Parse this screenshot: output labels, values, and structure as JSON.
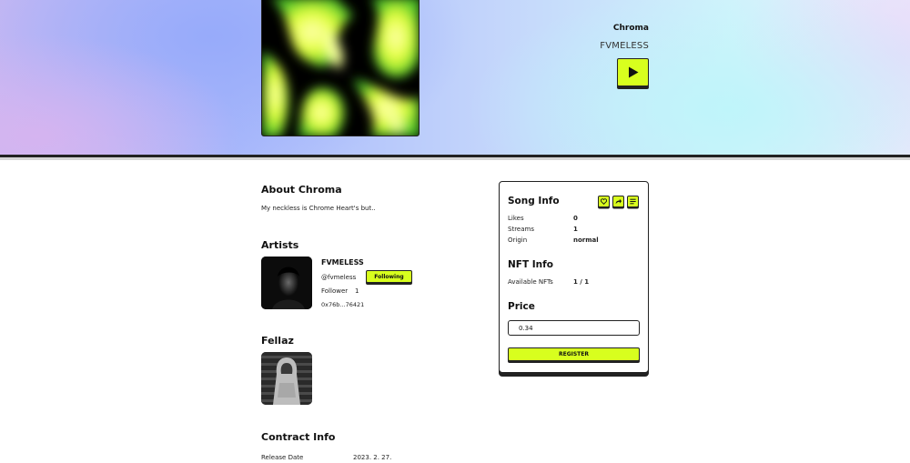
{
  "hero": {
    "song_title": "Chroma",
    "artist_name": "FVMELESS",
    "play_icon": "play-icon"
  },
  "about": {
    "title": "About Chroma",
    "description": "My neckless is Chrome Heart's but.."
  },
  "artists": {
    "title": "Artists",
    "name": "FVMELESS",
    "handle": "@fvmeless",
    "follow_label": "Following",
    "follower_label": "Follower",
    "follower_count": "1",
    "address": "0x76b...76421"
  },
  "fellaz": {
    "title": "Fellaz"
  },
  "contract": {
    "title": "Contract Info",
    "release_label": "Release Date",
    "release_value": "2023. 2. 27."
  },
  "song_info": {
    "title": "Song Info",
    "icons": [
      "heart-icon",
      "share-icon",
      "list-icon"
    ],
    "likes_label": "Likes",
    "likes_value": "0",
    "streams_label": "Streams",
    "streams_value": "1",
    "origin_label": "Origin",
    "origin_value": "normal"
  },
  "nft_info": {
    "title": "NFT Info",
    "available_label": "Available NFTs",
    "available_value": "1 / 1"
  },
  "price": {
    "title": "Price",
    "value": "0.34",
    "register_label": "REGISTER"
  },
  "colors": {
    "accent": "#d8ff1e",
    "border": "#222222"
  }
}
